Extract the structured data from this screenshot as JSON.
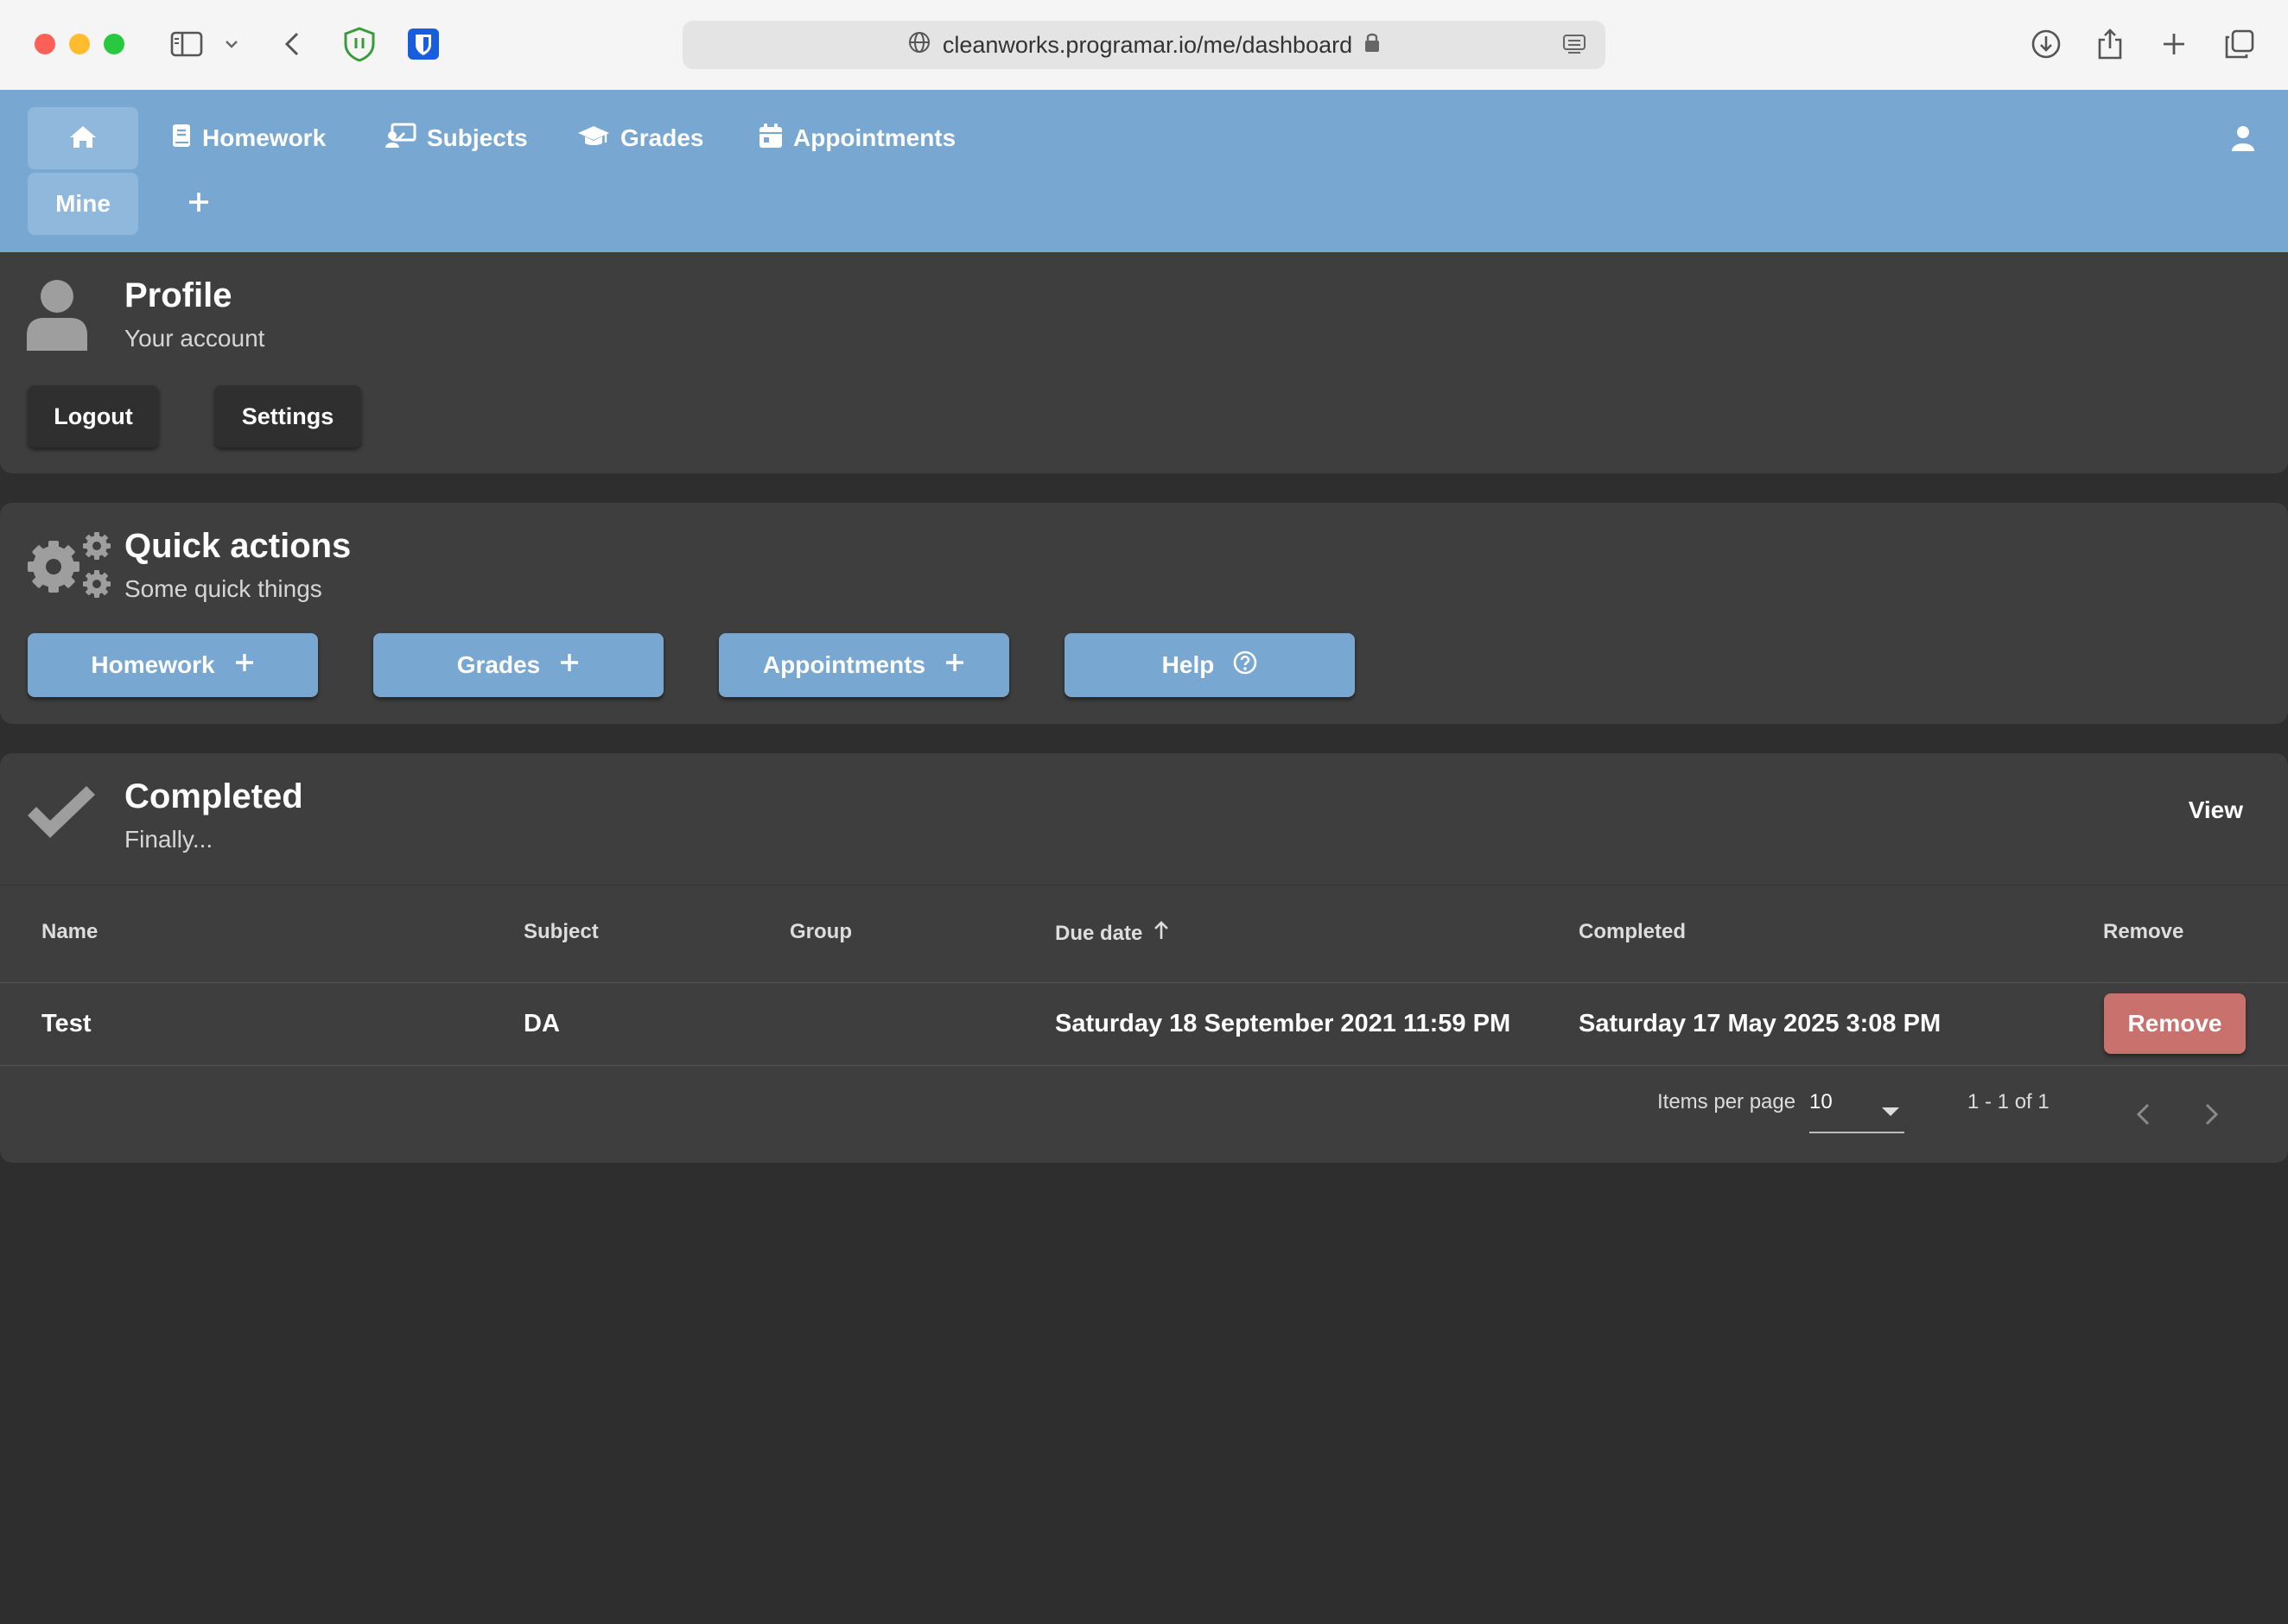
{
  "browser": {
    "url": "cleanworks.programar.io/me/dashboard"
  },
  "nav": {
    "items": [
      {
        "label": "Homework",
        "icon": "book-icon"
      },
      {
        "label": "Subjects",
        "icon": "teacher-icon"
      },
      {
        "label": "Grades",
        "icon": "graduation-cap-icon"
      },
      {
        "label": "Appointments",
        "icon": "calendar-icon"
      }
    ],
    "mine_label": "Mine"
  },
  "profile": {
    "title": "Profile",
    "subtitle": "Your account",
    "logout_label": "Logout",
    "settings_label": "Settings"
  },
  "quick_actions": {
    "title": "Quick actions",
    "subtitle": "Some quick things",
    "buttons": [
      {
        "label": "Homework",
        "icon": "plus-icon"
      },
      {
        "label": "Grades",
        "icon": "plus-icon"
      },
      {
        "label": "Appointments",
        "icon": "plus-icon"
      },
      {
        "label": "Help",
        "icon": "help-circle-icon"
      }
    ]
  },
  "completed": {
    "title": "Completed",
    "subtitle": "Finally...",
    "view_label": "View",
    "columns": [
      "Name",
      "Subject",
      "Group",
      "Due date",
      "Completed",
      "Remove"
    ],
    "rows": [
      {
        "name": "Test",
        "subject": "DA",
        "group": "",
        "due_date": "Saturday 18 September 2021 11:59 PM",
        "completed": "Saturday 17 May 2025 3:08 PM",
        "remove_label": "Remove"
      }
    ],
    "pagination": {
      "items_per_page_label": "Items per page",
      "items_per_page": "10",
      "range": "1 - 1 of 1"
    }
  },
  "colors": {
    "nav_bg": "#78a7d1",
    "card_bg": "#3e3e3e",
    "page_bg": "#2e2e2e",
    "remove_bg": "#c9716c"
  }
}
